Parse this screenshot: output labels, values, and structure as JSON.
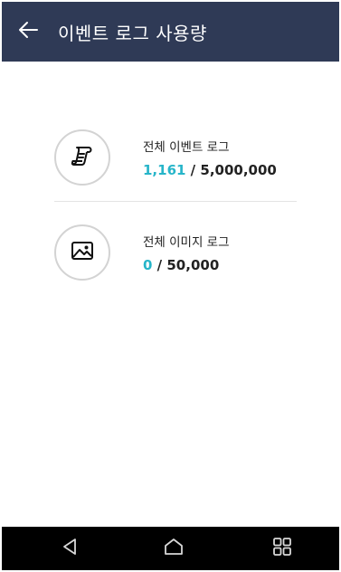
{
  "appbar": {
    "title": "이벤트 로그 사용량",
    "back_icon": "arrow-left-icon"
  },
  "stats": [
    {
      "icon": "scroll-document-icon",
      "label": "전체 이벤트 로그",
      "used": "1,161",
      "separator": " / ",
      "limit": "5,000,000"
    },
    {
      "icon": "image-icon",
      "label": "전체 이미지 로그",
      "used": "0",
      "separator": " / ",
      "limit": "50,000"
    }
  ],
  "colors": {
    "appbar_bg": "#2f3a56",
    "used_accent": "#27b5c9",
    "navbar_bg": "#000000"
  },
  "navbar": {
    "back_icon": "triangle-back-icon",
    "home_icon": "home-icon",
    "recent_icon": "recent-apps-icon"
  }
}
